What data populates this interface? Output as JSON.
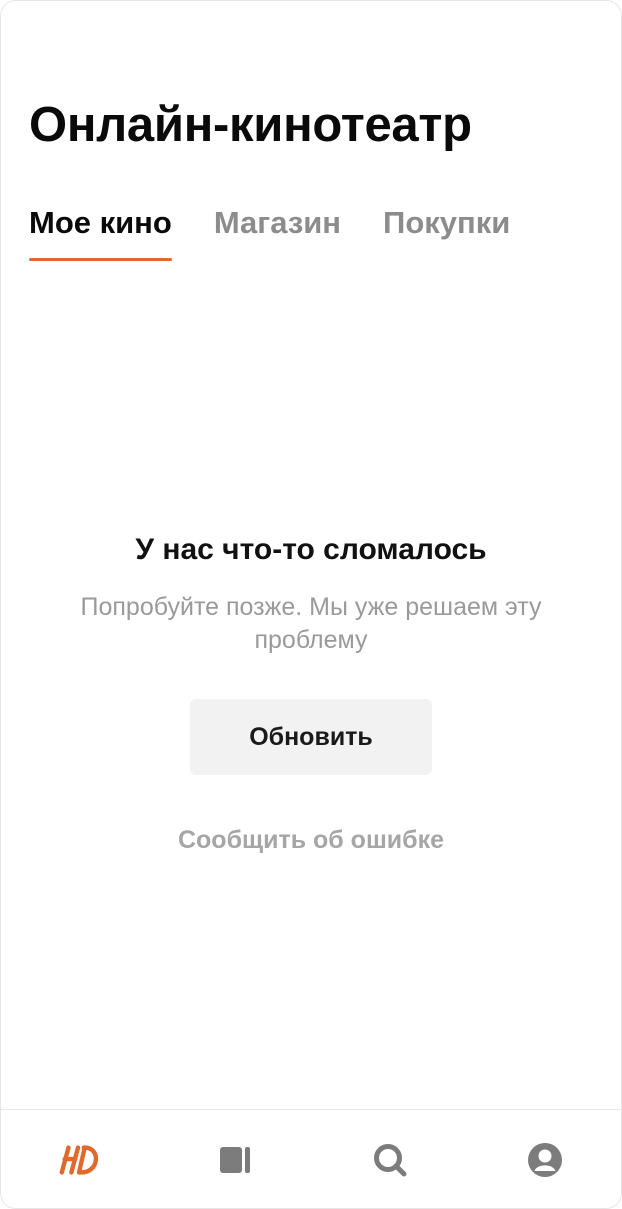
{
  "header": {
    "title": "Онлайн-кинотеатр"
  },
  "tabs": [
    {
      "label": "Мое кино",
      "active": true
    },
    {
      "label": "Магазин",
      "active": false
    },
    {
      "label": "Покупки",
      "active": false
    }
  ],
  "error": {
    "title": "У нас что-то сломалось",
    "subtitle": "Попробуйте позже. Мы уже решаем эту проблему",
    "refresh_label": "Обновить",
    "report_label": "Сообщить об ошибке"
  },
  "bottom_nav": {
    "items": [
      {
        "icon": "hd-logo-icon",
        "active": true
      },
      {
        "icon": "library-icon",
        "active": false
      },
      {
        "icon": "search-icon",
        "active": false
      },
      {
        "icon": "profile-icon",
        "active": false
      }
    ]
  },
  "colors": {
    "accent": "#e06a2b",
    "text_primary": "#0a0a0a",
    "text_secondary": "#9a9a9a",
    "icon_inactive": "#7c7c7c",
    "button_bg": "#f2f2f2"
  }
}
